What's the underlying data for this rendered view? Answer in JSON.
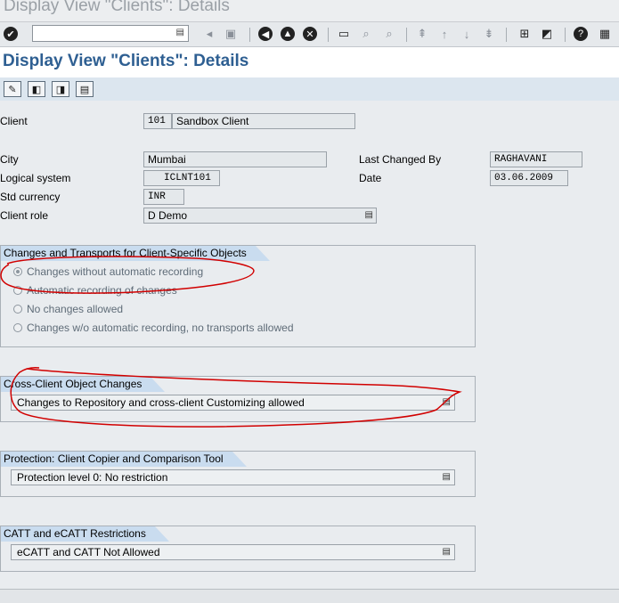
{
  "window": {
    "title": "Display View \"Clients\": Details"
  },
  "toolbar": {
    "command_value": "",
    "icons": [
      "enter-icon",
      "back-arrow-icon",
      "save-icon",
      "back-icon",
      "exit-icon",
      "cancel-icon",
      "print-icon",
      "find-icon",
      "find-next-icon",
      "first-page-icon",
      "previous-page-icon",
      "next-page-icon",
      "last-page-icon",
      "create-session-icon",
      "shortcut-icon",
      "help-icon",
      "layout-menu-icon"
    ]
  },
  "page": {
    "title": "Display View \"Clients\": Details"
  },
  "fields": {
    "client": {
      "label": "Client",
      "number": "101",
      "name": "Sandbox Client"
    },
    "city": {
      "label": "City",
      "value": "Mumbai"
    },
    "logical_system": {
      "label": "Logical system",
      "value": "ICLNT101"
    },
    "std_currency": {
      "label": "Std currency",
      "value": "INR"
    },
    "client_role": {
      "label": "Client role",
      "value": "D Demo"
    },
    "last_changed_by": {
      "label": "Last Changed By",
      "value": "RAGHAVANI"
    },
    "date": {
      "label": "Date",
      "value": "03.06.2009"
    }
  },
  "groups": {
    "changes_transports": {
      "title": "Changes and Transports for Client-Specific Objects",
      "options": [
        {
          "label": "Changes without automatic recording",
          "selected": true
        },
        {
          "label": "Automatic recording of changes",
          "selected": false
        },
        {
          "label": "No changes allowed",
          "selected": false
        },
        {
          "label": "Changes w/o automatic recording, no transports allowed",
          "selected": false
        }
      ]
    },
    "cross_client": {
      "title": "Cross-Client Object Changes",
      "value": "Changes to Repository and cross-client Customizing allowed"
    },
    "protection": {
      "title": "Protection: Client Copier and Comparison Tool",
      "value": "Protection level 0: No restriction"
    },
    "catt": {
      "title": "CATT and eCATT Restrictions",
      "value": "eCATT and CATT Not Allowed"
    }
  },
  "colors": {
    "header_text": "#2e5f92",
    "group_title_bg": "#c9dcef",
    "annotation": "#d10000"
  }
}
